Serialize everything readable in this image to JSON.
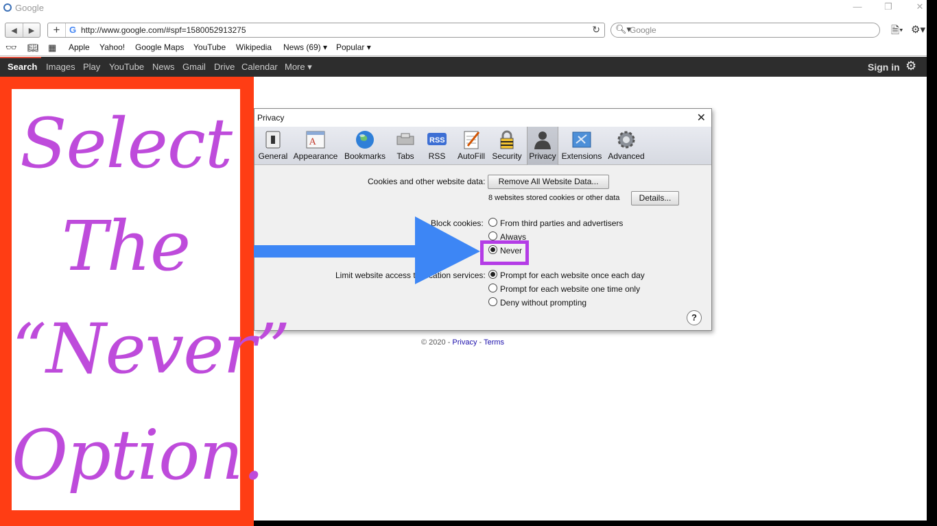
{
  "window": {
    "title": "Google"
  },
  "navbar": {
    "url": "http://www.google.com/#spf=1580052913275",
    "search_placeholder": "Google"
  },
  "bookmarks": [
    "Apple",
    "Yahoo!",
    "Google Maps",
    "YouTube",
    "Wikipedia",
    "News (69) ▾",
    "Popular ▾"
  ],
  "gbar": {
    "items": [
      "Search",
      "Images",
      "Play",
      "YouTube",
      "News",
      "Gmail",
      "Drive",
      "Calendar",
      "More ▾"
    ],
    "sign_in": "Sign in"
  },
  "annotation": {
    "lines": [
      "Select",
      "The",
      "“Never”",
      "Option."
    ],
    "text_color": "#be4bdb",
    "panel_color": "#ff3d14",
    "highlight_color": "#b43ce6",
    "arrow_color": "#3d86f5"
  },
  "dialog": {
    "title": "Privacy",
    "tabs": [
      {
        "label": "General",
        "icon": "switch-icon"
      },
      {
        "label": "Appearance",
        "icon": "appearance-icon"
      },
      {
        "label": "Bookmarks",
        "icon": "globe-icon"
      },
      {
        "label": "Tabs",
        "icon": "tabs-icon"
      },
      {
        "label": "RSS",
        "icon": "rss-icon"
      },
      {
        "label": "AutoFill",
        "icon": "autofill-icon"
      },
      {
        "label": "Security",
        "icon": "lock-icon"
      },
      {
        "label": "Privacy",
        "icon": "person-icon"
      },
      {
        "label": "Extensions",
        "icon": "extensions-icon"
      },
      {
        "label": "Advanced",
        "icon": "gear-icon"
      }
    ],
    "selected_tab": "Privacy",
    "cookies_label": "Cookies and other website data:",
    "remove_button": "Remove All Website Data...",
    "stored_text": "8 websites stored cookies or other data",
    "details_button": "Details...",
    "block_label": "Block cookies:",
    "block_options": [
      "From third parties and advertisers",
      "Always",
      "Never"
    ],
    "block_selected": "Never",
    "location_label": "Limit website access to location services:",
    "location_options": [
      "Prompt for each website once each day",
      "Prompt for each website one time only",
      "Deny without prompting"
    ],
    "location_selected": "Prompt for each website once each day",
    "help": "?"
  },
  "footer": {
    "copyright": "© 2020 -",
    "privacy": "Privacy",
    "sep": "-",
    "terms": "Terms"
  }
}
